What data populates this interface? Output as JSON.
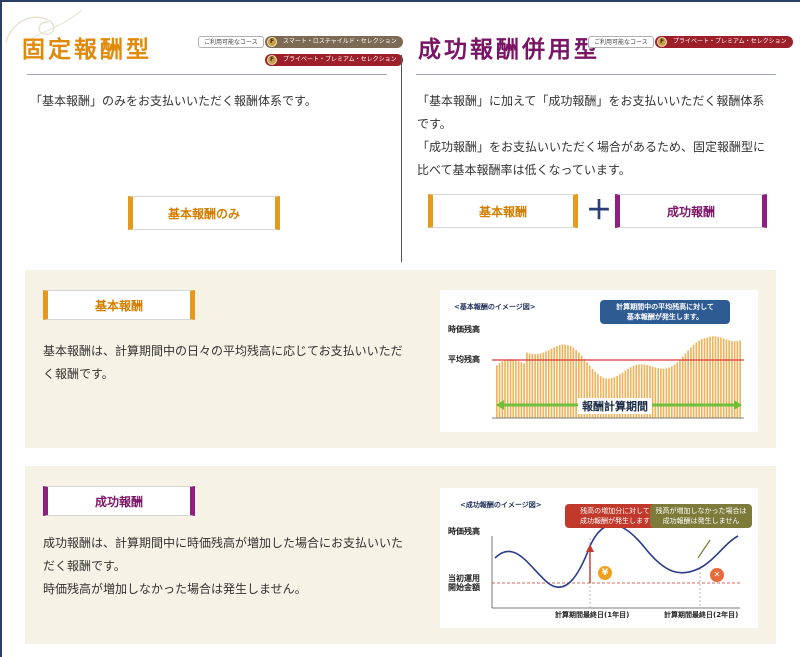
{
  "left_plan": {
    "title": "固定報酬型",
    "courses_label": "ご利用可能なコース",
    "course_badges": [
      "スマート・ロスチャイルド・セレクション",
      "プライベート・プレミアム・セレクション"
    ],
    "description": "「基本報酬」のみをお支払いいただく報酬体系です。",
    "fee_box_label": "基本報酬のみ"
  },
  "right_plan": {
    "title": "成功報酬併用型",
    "courses_label": "ご利用可能なコース",
    "course_badges": [
      "プライベート・プレミアム・セレクション"
    ],
    "description_lines": [
      "「基本報酬」に加えて「成功報酬」をお支払いいただく報酬体系",
      "です。",
      "「成功報酬」をお支払いいただく場合があるため、固定報酬型に",
      "比べて基本報酬率は低くなっています。"
    ],
    "base_box_label": "基本報酬",
    "plus_symbol": "＋",
    "success_box_label": "成功報酬"
  },
  "basic_section": {
    "heading": "基本報酬",
    "text_lines": [
      "基本報酬は、計算期間中の日々の平均残高に応じてお支払いいただ",
      "く報酬です。"
    ],
    "chart": {
      "title": "<基本報酬のイメージ図>",
      "callout": [
        "計算期間中の平均残高に対して",
        "基本報酬が発生します。"
      ],
      "y_label_daily": "時価残高",
      "y_label_avg": "平均残高",
      "period_label": "報酬計算期間",
      "colors": {
        "bars": "#f0b25a",
        "average": "#d63a3a",
        "arrow": "#6fbf3a",
        "callout": "#2f5b93"
      }
    }
  },
  "success_section": {
    "heading": "成功報酬",
    "text_lines": [
      "成功報酬は、計算期間中に時価残高が増加した場合にお支払いいた",
      "だく報酬です。",
      "時価残高が増加しなかった場合は発生しません。"
    ],
    "chart": {
      "title": "<成功報酬のイメージ図>",
      "callout_red": [
        "残高の増加分に対して",
        "成功報酬が発生します"
      ],
      "callout_olive": [
        "残高が増加しなかった場合は",
        "成功報酬は発生しません"
      ],
      "y_label_value": "時価残高",
      "y_label_start": [
        "当初運用",
        "開始金額"
      ],
      "x_label_1": "計算期間最終日(1年目)",
      "x_label_2": "計算期間最終日(2年目)",
      "yen_symbol": "¥",
      "cross_symbol": "✕",
      "colors": {
        "curve": "#2a3c8c",
        "red": "#c0392b",
        "olive": "#7d7a3a",
        "yen": "#f0a020"
      }
    }
  }
}
